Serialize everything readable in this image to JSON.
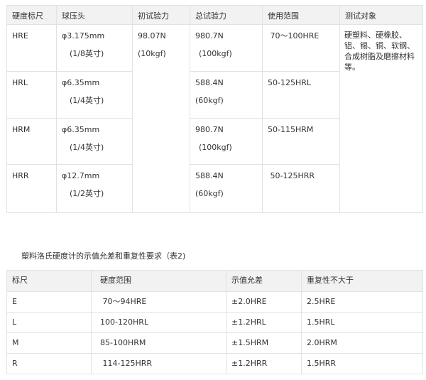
{
  "table1": {
    "headers": [
      "硬度标尺",
      "球压头",
      "初试验力",
      "总试验力",
      "使用范围",
      "测试对象"
    ],
    "initial_force": [
      "98.07N",
      "(10kgf)"
    ],
    "test_object": "硬塑料、硬橡胶、铝、锡、铜、软钢、合成树脂及磨擦材料等。",
    "rows": [
      {
        "scale": "HRE",
        "ball": "φ3.175mm",
        "ball_inch": "(1/8英寸)",
        "total": "980.7N",
        "total_kgf": "(100kgf)",
        "range": " 70～100HRE"
      },
      {
        "scale": "HRL",
        "ball": "φ6.35mm",
        "ball_inch": "(1/4英寸)",
        "total": "588.4N",
        "total_kgf": "(60kgf)",
        "range": "50-125HRL"
      },
      {
        "scale": "HRM",
        "ball": "φ6.35mm",
        "ball_inch": "(1/4英寸)",
        "total": "980.7N",
        "total_kgf": "(100kgf)",
        "range": "50-115HRM"
      },
      {
        "scale": "HRR",
        "ball": "φ12.7mm",
        "ball_inch": "(1/2英寸)",
        "total": "588.4N",
        "total_kgf": "(60kgf)",
        "range": " 50-125HRR"
      }
    ]
  },
  "caption": "塑料洛氏硬度计的示值允差和重复性要求（表2)",
  "table2": {
    "headers": [
      "标尺",
      "硬度范围",
      "示值允差",
      "重复性不大于"
    ],
    "rows": [
      {
        "scale": "E",
        "range": " 70～94HRE",
        "tolerance": "±2.0HRE",
        "repeat": "2.5HRE"
      },
      {
        "scale": "L",
        "range": "100-120HRL",
        "tolerance": "±1.2HRL",
        "repeat": "1.5HRL"
      },
      {
        "scale": "M",
        "range": "85-100HRM",
        "tolerance": "±1.5HRM",
        "repeat": "2.0HRM"
      },
      {
        "scale": "R",
        "range": " 114-125HRR",
        "tolerance": "±1.2HRR",
        "repeat": "1.5HRR"
      }
    ]
  }
}
